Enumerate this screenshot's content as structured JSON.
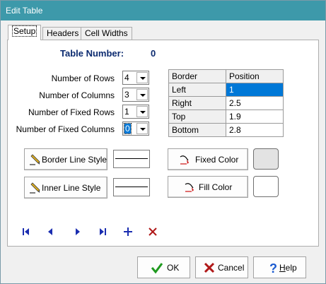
{
  "window": {
    "title": "Edit Table"
  },
  "tabs": [
    {
      "label": "Setup"
    },
    {
      "label": "Headers"
    },
    {
      "label": "Cell Widths"
    }
  ],
  "table_number": {
    "label": "Table Number:",
    "value": "0"
  },
  "fields": {
    "rows": {
      "label": "Number of Rows",
      "value": "4"
    },
    "columns": {
      "label": "Number of Columns",
      "value": "3"
    },
    "fixed_rows": {
      "label": "Number of Fixed Rows",
      "value": "1"
    },
    "fixed_columns": {
      "label": "Number of Fixed Columns",
      "value": "0"
    }
  },
  "grid": {
    "headers": [
      "Border",
      "Position"
    ],
    "rows": [
      [
        "Left",
        "1"
      ],
      [
        "Right",
        "2.5"
      ],
      [
        "Top",
        "1.9"
      ],
      [
        "Bottom",
        "2.8"
      ]
    ]
  },
  "buttons": {
    "border_line_style": "Border Line Style",
    "inner_line_style": "Inner Line Style",
    "fixed_color": "Fixed Color",
    "fill_color": "Fill Color",
    "ok": "OK",
    "cancel": "Cancel",
    "help": "Help"
  },
  "colors": {
    "fixed_color": "#e3e3e3",
    "fill_color": "#ffffff",
    "accent": "#3d99aa",
    "selection": "#0078d7",
    "nav_blue": "#1a2db0",
    "delete_red": "#b01818"
  },
  "nav_icons": [
    "first-record-icon",
    "previous-record-icon",
    "next-record-icon",
    "last-record-icon",
    "add-record-icon",
    "delete-record-icon"
  ]
}
